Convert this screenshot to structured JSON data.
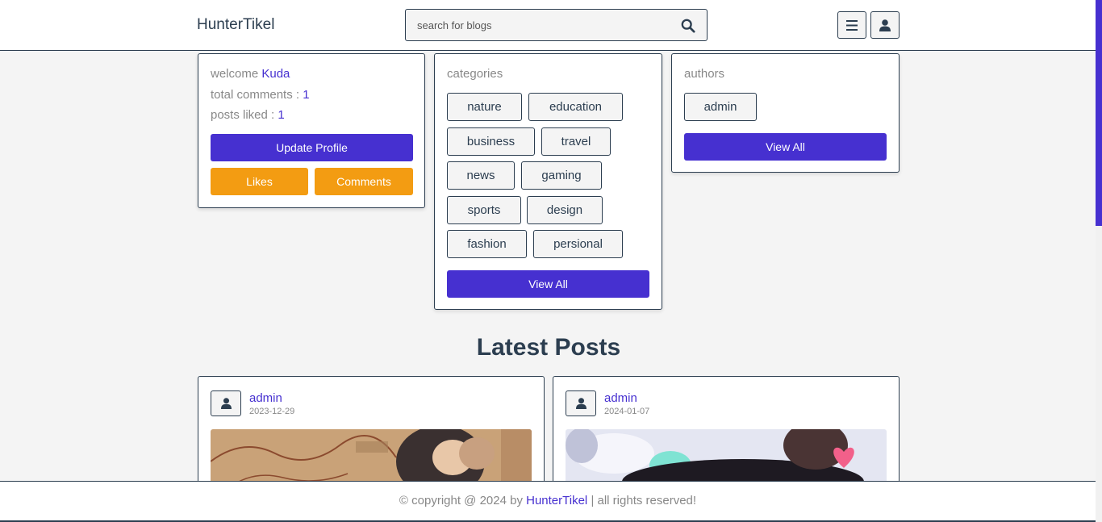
{
  "header": {
    "brand": "HunterTikel",
    "search_placeholder": "search for blogs"
  },
  "profile_box": {
    "welcome_label": "welcome",
    "user_name": "Kuda",
    "comments_label": "total comments :",
    "comments_count": "1",
    "likes_label": "posts liked :",
    "likes_count": "1",
    "update_button": "Update Profile",
    "likes_button": "Likes",
    "comments_button": "Comments"
  },
  "categories_box": {
    "title": "categories",
    "items": [
      "nature",
      "education",
      "business",
      "travel",
      "news",
      "gaming",
      "sports",
      "design",
      "fashion",
      "persional"
    ],
    "view_all": "View All"
  },
  "authors_box": {
    "title": "authors",
    "items": [
      "admin"
    ],
    "view_all": "View All"
  },
  "latest": {
    "title": "Latest Posts",
    "posts": [
      {
        "author": "admin",
        "date": "2023-12-29"
      },
      {
        "author": "admin",
        "date": "2024-01-07"
      }
    ]
  },
  "footer": {
    "prefix": "© copyright @ 2024 by",
    "brand": "HunterTikel",
    "suffix": "| all rights reserved!"
  },
  "colors": {
    "accent": "#4630d0",
    "orange": "#f39c12",
    "dark": "#2c3e50",
    "background": "#f4f4f4"
  },
  "icons": {
    "search": "search-icon",
    "menu": "menu-icon",
    "user": "user-icon"
  }
}
